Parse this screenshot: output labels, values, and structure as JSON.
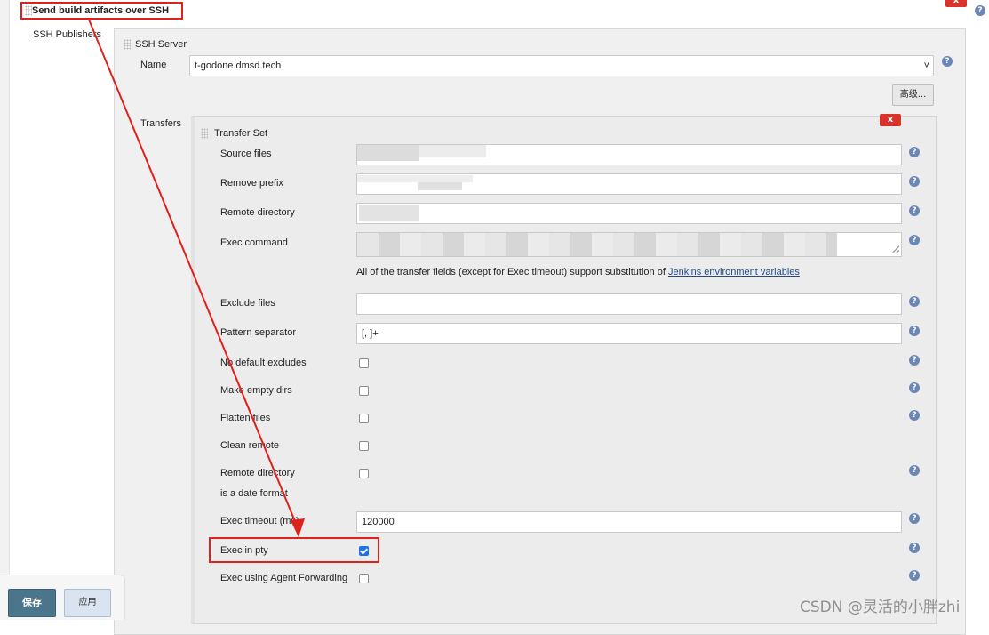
{
  "section": {
    "title": "Send build artifacts over SSH",
    "publishers_label": "SSH Publishers"
  },
  "ssh_server": {
    "title": "SSH Server",
    "name_label": "Name",
    "name_value": "t-godone.dmsd.tech",
    "advanced_button": "高级..."
  },
  "transfers": {
    "label": "Transfers",
    "set_title": "Transfer Set",
    "delete_label": "x",
    "fields": {
      "source_files": "Source files",
      "remove_prefix": "Remove prefix",
      "remote_directory": "Remote directory",
      "exec_command": "Exec command",
      "exclude_files": "Exclude files",
      "pattern_separator": "Pattern separator",
      "pattern_separator_value": "[, ]+",
      "no_default_excludes": "No default excludes",
      "make_empty_dirs": "Make empty dirs",
      "flatten_files": "Flatten files",
      "clean_remote": "Clean remote",
      "remote_dir_date_1": "Remote directory",
      "remote_dir_date_2": "is a date format",
      "exec_timeout": "Exec timeout (ms)",
      "exec_timeout_value": "120000",
      "exec_in_pty": "Exec in pty",
      "exec_agent_forwarding": "Exec using Agent Forwarding"
    },
    "note_text": "All of the transfer fields (except for Exec timeout) support substitution of ",
    "note_link": "Jenkins environment variables"
  },
  "buttons": {
    "save": "保存",
    "apply": "应用"
  },
  "watermark": "CSDN @灵活的小胖zhi",
  "help_glyph": "?",
  "close_glyph": "x",
  "colors": {
    "annotation_red": "#e0201b",
    "save_bg": "#4b758b",
    "help_blue": "#6a87b5"
  }
}
